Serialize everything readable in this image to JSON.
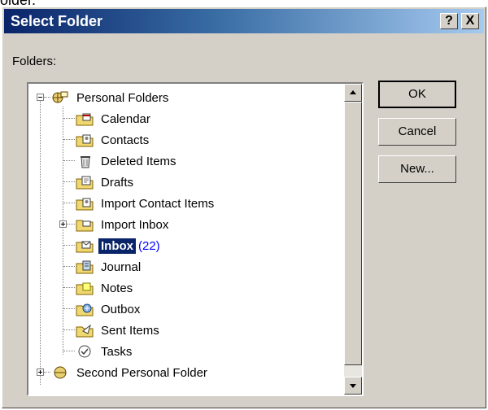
{
  "clipped_text": "older.",
  "window": {
    "title": "Select Folder",
    "help_label": "?",
    "close_label": "X"
  },
  "folders_label": "Folders:",
  "tree": {
    "root": "Personal Folders",
    "items": [
      {
        "label": "Calendar",
        "icon": "calendar-folder-icon"
      },
      {
        "label": "Contacts",
        "icon": "contacts-folder-icon"
      },
      {
        "label": "Deleted Items",
        "icon": "deleted-items-icon"
      },
      {
        "label": "Drafts",
        "icon": "drafts-folder-icon"
      },
      {
        "label": "Import Contact Items",
        "icon": "contacts-folder-icon"
      },
      {
        "label": "Import Inbox",
        "icon": "folder-icon"
      },
      {
        "label": "Inbox",
        "icon": "inbox-folder-icon",
        "count": "(22)",
        "selected": true
      },
      {
        "label": "Journal",
        "icon": "journal-folder-icon"
      },
      {
        "label": "Notes",
        "icon": "notes-folder-icon"
      },
      {
        "label": "Outbox",
        "icon": "outbox-folder-icon"
      },
      {
        "label": "Sent Items",
        "icon": "sent-items-icon"
      },
      {
        "label": "Tasks",
        "icon": "tasks-folder-icon"
      }
    ],
    "second_root": "Second Personal Folder"
  },
  "buttons": {
    "ok": "OK",
    "cancel": "Cancel",
    "new": "New..."
  },
  "colors": {
    "title_gradient_start": "#0a246a",
    "title_gradient_end": "#a6caf0",
    "selection": "#0a246a",
    "count": "#0000ff",
    "dialog_face": "#d4d0c8"
  }
}
